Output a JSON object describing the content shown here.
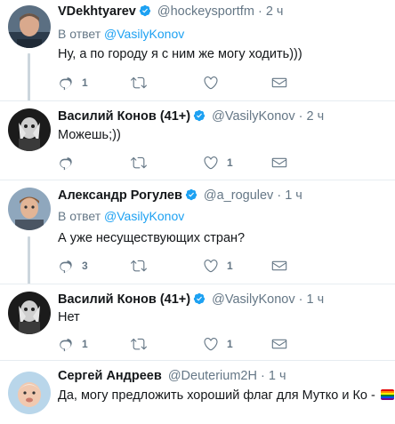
{
  "colors": {
    "link": "#1da1f2",
    "muted": "#657786",
    "text": "#14171a",
    "border": "#e6ecf0",
    "thread": "#ccd6dd"
  },
  "tweets": [
    {
      "name": "VDekhtyarev",
      "verified": true,
      "handle": "@hockeysportfm",
      "dot": "·",
      "time": "2 ч",
      "reply_prefix": "В ответ",
      "reply_to": "@VasilyKonov",
      "text": "Ну, а по городу я с ним же могу ходить)))",
      "replies": "1",
      "retweets": "",
      "likes": ""
    },
    {
      "name": "Василий Конов (41+)",
      "verified": true,
      "handle": "@VasilyKonov",
      "dot": "·",
      "time": "2 ч",
      "text": "Можешь;))",
      "replies": "",
      "retweets": "",
      "likes": "1"
    },
    {
      "name": "Александр Рогулев",
      "verified": true,
      "handle": "@a_rogulev",
      "dot": "·",
      "time": "1 ч",
      "reply_prefix": "В ответ",
      "reply_to": "@VasilyKonov",
      "text": "А уже несуществующих стран?",
      "replies": "3",
      "retweets": "",
      "likes": "1"
    },
    {
      "name": "Василий Конов (41+)",
      "verified": true,
      "handle": "@VasilyKonov",
      "dot": "·",
      "time": "1 ч",
      "text": "Нет",
      "replies": "1",
      "retweets": "",
      "likes": "1"
    },
    {
      "name": "Сергей Андреев",
      "verified": false,
      "handle": "@Deuterium2H",
      "dot": "·",
      "time": "1 ч",
      "text": "Да, могу предложить хороший флаг для Мутко и Ко -",
      "flag": "rainbow-flag-emoji"
    }
  ]
}
